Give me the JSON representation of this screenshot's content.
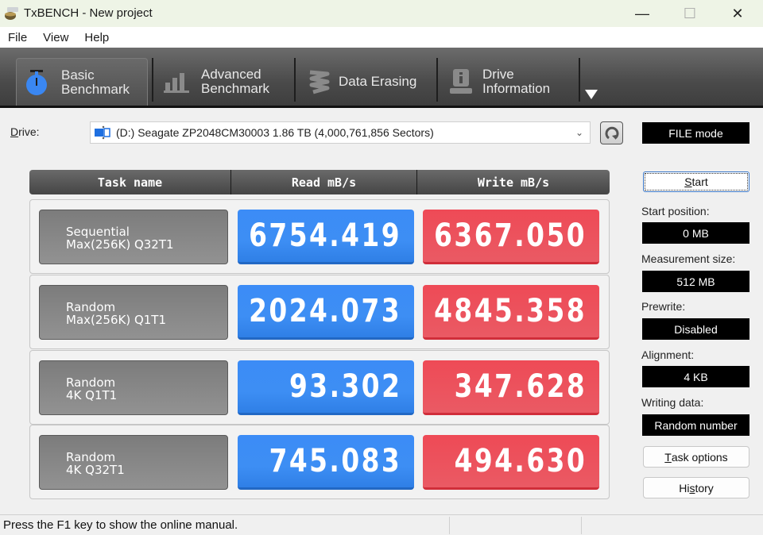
{
  "window": {
    "title": "TxBENCH - New project",
    "controls": {
      "minimize": "—",
      "maximize": "☐",
      "close": "✕"
    }
  },
  "menu": [
    "File",
    "View",
    "Help"
  ],
  "toolbar": {
    "tabs": [
      {
        "line1": "Basic",
        "line2": "Benchmark",
        "icon": "stopwatch-icon",
        "active": true
      },
      {
        "line1": "Advanced",
        "line2": "Benchmark",
        "icon": "bar-chart-icon",
        "active": false
      },
      {
        "line1": "Data Erasing",
        "line2": "",
        "icon": "eraser-spring-icon",
        "active": false
      },
      {
        "line1": "Drive",
        "line2": "Information",
        "icon": "drive-info-icon",
        "active": false
      }
    ],
    "overflow_icon": "triangle-down-icon"
  },
  "drive": {
    "label_prefix": "D",
    "label_rest": "rive:",
    "selected": "(D:) Seagate ZP2048CM30003  1.86 TB (4,000,761,856 Sectors)",
    "mode": "FILE mode"
  },
  "table": {
    "headers": {
      "task": "Task name",
      "read": "Read mB/s",
      "write": "Write mB/s"
    },
    "rows": [
      {
        "line1": "Sequential",
        "line2": "Max(256K) Q32T1",
        "read": "6754.419",
        "write": "6367.050"
      },
      {
        "line1": "Random",
        "line2": "Max(256K) Q1T1",
        "read": "2024.073",
        "write": "4845.358"
      },
      {
        "line1": "Random",
        "line2": "4K Q1T1",
        "read": "93.302",
        "write": "347.628"
      },
      {
        "line1": "Random",
        "line2": "4K Q32T1",
        "read": "745.083",
        "write": "494.630"
      }
    ]
  },
  "side": {
    "start_u": "S",
    "start_rest": "tart",
    "start_position_label": "Start position:",
    "start_position": "0 MB",
    "measurement_size_label": "Measurement size:",
    "measurement_size": "512 MB",
    "prewrite_label": "Prewrite:",
    "prewrite": "Disabled",
    "alignment_label": "Alignment:",
    "alignment": "4 KB",
    "writing_data_label": "Writing data:",
    "writing_data": "Random number",
    "task_options_u": "T",
    "task_options_rest": "ask options",
    "history_pre": "Hi",
    "history_u": "s",
    "history_rest": "tory"
  },
  "colors": {
    "read": "#3d8ef4",
    "write": "#ec4f5b",
    "toolbar": "#4a4a4a"
  },
  "status": {
    "text": "Press the F1 key to show the online manual."
  }
}
